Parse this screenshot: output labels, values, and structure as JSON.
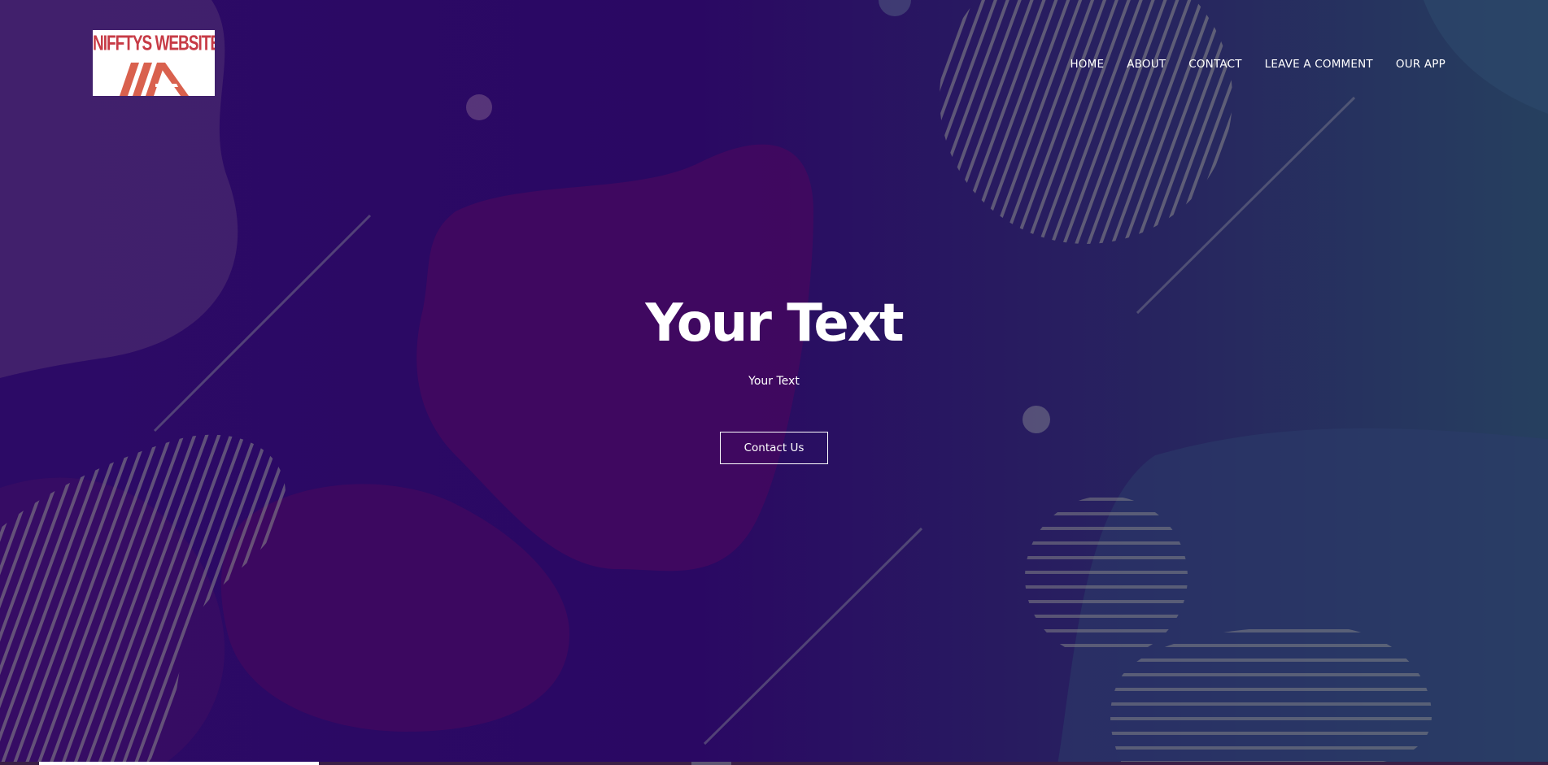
{
  "logo": {
    "text": "NIFFTYS WEBSITE DESIGNS",
    "accent": "#c73b46",
    "mark_color": "#d9614e"
  },
  "nav": {
    "items": [
      {
        "label": "HOME"
      },
      {
        "label": "ABOUT"
      },
      {
        "label": "CONTACT"
      },
      {
        "label": "LEAVE A COMMENT"
      },
      {
        "label": "OUR APP"
      }
    ]
  },
  "hero": {
    "title": "Your Text",
    "subtitle": "Your Text",
    "cta_label": "Contact Us"
  },
  "colors": {
    "background_deep": "#2a0a63",
    "background_blue": "#26305f",
    "blob_magenta": "#43085f",
    "text": "#ffffff"
  }
}
